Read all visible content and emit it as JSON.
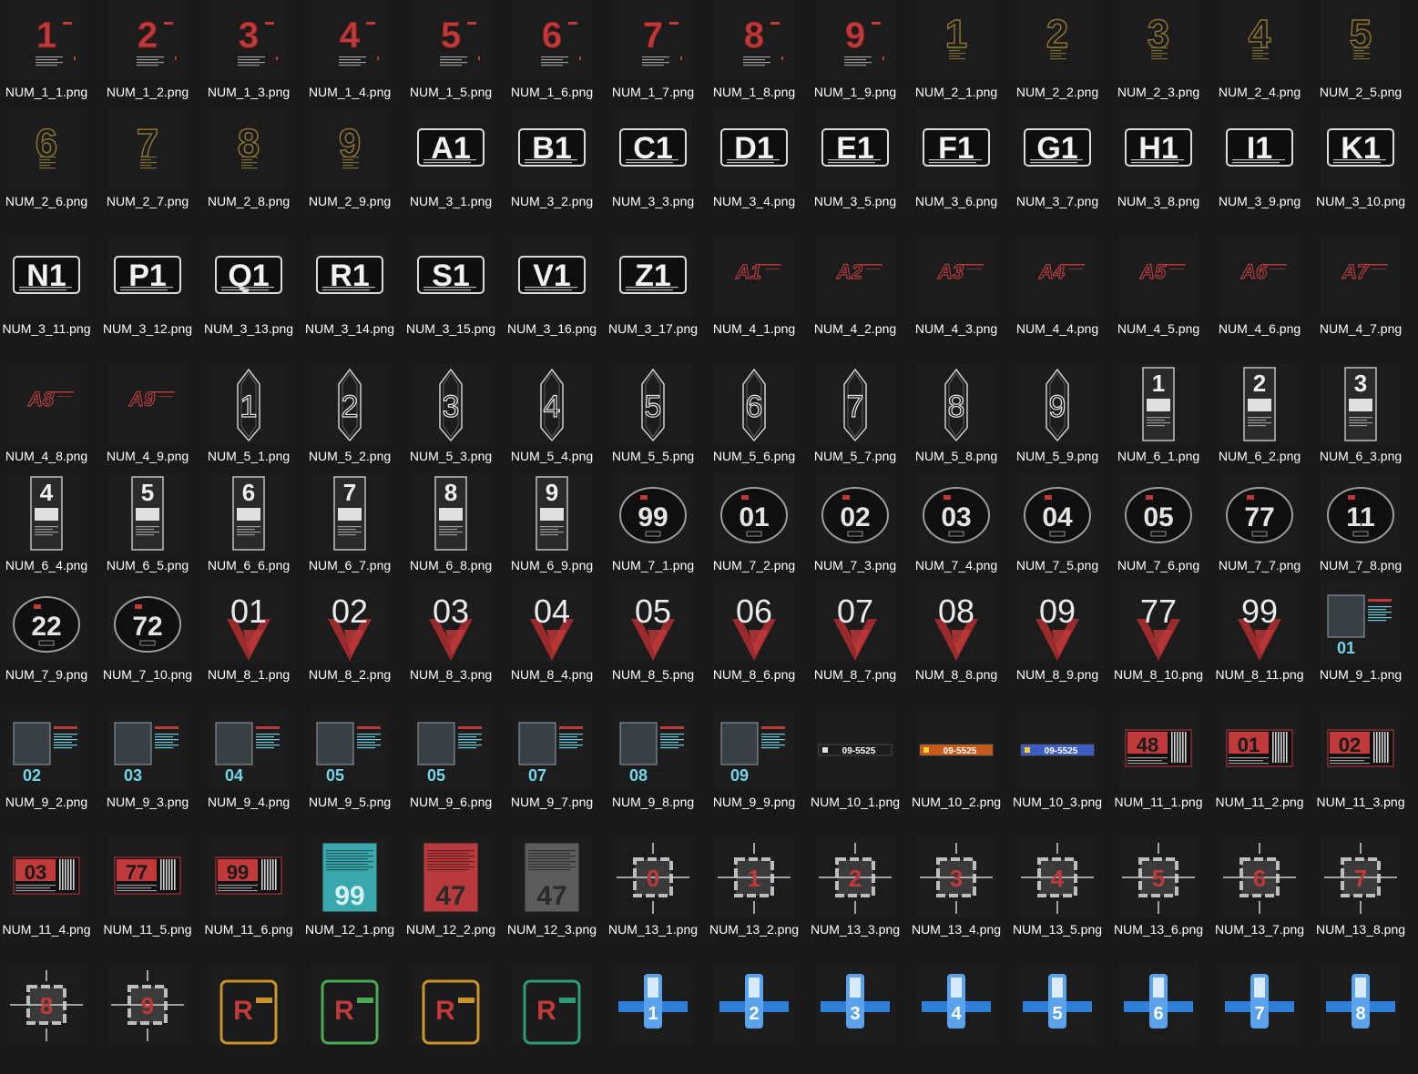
{
  "view": {
    "background": "#191919",
    "label_color": "#ffffff"
  },
  "files": [
    {
      "name": "NUM_1_1.png",
      "glyph": "1",
      "style": "red-block"
    },
    {
      "name": "NUM_1_2.png",
      "glyph": "2",
      "style": "red-block"
    },
    {
      "name": "NUM_1_3.png",
      "glyph": "3",
      "style": "red-block"
    },
    {
      "name": "NUM_1_4.png",
      "glyph": "4",
      "style": "red-block"
    },
    {
      "name": "NUM_1_5.png",
      "glyph": "5",
      "style": "red-block"
    },
    {
      "name": "NUM_1_6.png",
      "glyph": "6",
      "style": "red-block"
    },
    {
      "name": "NUM_1_7.png",
      "glyph": "7",
      "style": "red-block"
    },
    {
      "name": "NUM_1_8.png",
      "glyph": "8",
      "style": "red-block"
    },
    {
      "name": "NUM_1_9.png",
      "glyph": "9",
      "style": "red-block"
    },
    {
      "name": "NUM_2_1.png",
      "glyph": "1",
      "style": "gold-outline"
    },
    {
      "name": "NUM_2_2.png",
      "glyph": "2",
      "style": "gold-outline"
    },
    {
      "name": "NUM_2_3.png",
      "glyph": "3",
      "style": "gold-outline"
    },
    {
      "name": "NUM_2_4.png",
      "glyph": "4",
      "style": "gold-outline"
    },
    {
      "name": "NUM_2_5.png",
      "glyph": "5",
      "style": "gold-outline"
    },
    {
      "name": "NUM_2_6.png",
      "glyph": "6",
      "style": "gold-outline"
    },
    {
      "name": "NUM_2_7.png",
      "glyph": "7",
      "style": "gold-outline"
    },
    {
      "name": "NUM_2_8.png",
      "glyph": "8",
      "style": "gold-outline"
    },
    {
      "name": "NUM_2_9.png",
      "glyph": "9",
      "style": "gold-outline"
    },
    {
      "name": "NUM_3_1.png",
      "glyph": "A1",
      "style": "white-plate"
    },
    {
      "name": "NUM_3_2.png",
      "glyph": "B1",
      "style": "white-plate"
    },
    {
      "name": "NUM_3_3.png",
      "glyph": "C1",
      "style": "white-plate"
    },
    {
      "name": "NUM_3_4.png",
      "glyph": "D1",
      "style": "white-plate"
    },
    {
      "name": "NUM_3_5.png",
      "glyph": "E1",
      "style": "white-plate"
    },
    {
      "name": "NUM_3_6.png",
      "glyph": "F1",
      "style": "white-plate"
    },
    {
      "name": "NUM_3_7.png",
      "glyph": "G1",
      "style": "white-plate"
    },
    {
      "name": "NUM_3_8.png",
      "glyph": "H1",
      "style": "white-plate"
    },
    {
      "name": "NUM_3_9.png",
      "glyph": "I1",
      "style": "white-plate"
    },
    {
      "name": "NUM_3_10.png",
      "glyph": "K1",
      "style": "white-plate"
    },
    {
      "name": "NUM_3_11.png",
      "glyph": "N1",
      "style": "white-plate"
    },
    {
      "name": "NUM_3_12.png",
      "glyph": "P1",
      "style": "white-plate"
    },
    {
      "name": "NUM_3_13.png",
      "glyph": "Q1",
      "style": "white-plate"
    },
    {
      "name": "NUM_3_14.png",
      "glyph": "R1",
      "style": "white-plate"
    },
    {
      "name": "NUM_3_15.png",
      "glyph": "S1",
      "style": "white-plate"
    },
    {
      "name": "NUM_3_16.png",
      "glyph": "V1",
      "style": "white-plate"
    },
    {
      "name": "NUM_3_17.png",
      "glyph": "Z1",
      "style": "white-plate"
    },
    {
      "name": "NUM_4_1.png",
      "glyph": "A1",
      "style": "red-outline"
    },
    {
      "name": "NUM_4_2.png",
      "glyph": "A2",
      "style": "red-outline"
    },
    {
      "name": "NUM_4_3.png",
      "glyph": "A3",
      "style": "red-outline"
    },
    {
      "name": "NUM_4_4.png",
      "glyph": "A4",
      "style": "red-outline"
    },
    {
      "name": "NUM_4_5.png",
      "glyph": "A5",
      "style": "red-outline"
    },
    {
      "name": "NUM_4_6.png",
      "glyph": "A6",
      "style": "red-outline"
    },
    {
      "name": "NUM_4_7.png",
      "glyph": "A7",
      "style": "red-outline"
    },
    {
      "name": "NUM_4_8.png",
      "glyph": "A8",
      "style": "red-outline"
    },
    {
      "name": "NUM_4_9.png",
      "glyph": "A9",
      "style": "red-outline"
    },
    {
      "name": "NUM_5_1.png",
      "glyph": "1",
      "style": "floor-hex"
    },
    {
      "name": "NUM_5_2.png",
      "glyph": "2",
      "style": "floor-hex"
    },
    {
      "name": "NUM_5_3.png",
      "glyph": "3",
      "style": "floor-hex"
    },
    {
      "name": "NUM_5_4.png",
      "glyph": "4",
      "style": "floor-hex"
    },
    {
      "name": "NUM_5_5.png",
      "glyph": "5",
      "style": "floor-hex"
    },
    {
      "name": "NUM_5_6.png",
      "glyph": "6",
      "style": "floor-hex"
    },
    {
      "name": "NUM_5_7.png",
      "glyph": "7",
      "style": "floor-hex"
    },
    {
      "name": "NUM_5_8.png",
      "glyph": "8",
      "style": "floor-hex"
    },
    {
      "name": "NUM_5_9.png",
      "glyph": "9",
      "style": "floor-hex"
    },
    {
      "name": "NUM_6_1.png",
      "glyph": "1",
      "style": "tall-panel"
    },
    {
      "name": "NUM_6_2.png",
      "glyph": "2",
      "style": "tall-panel"
    },
    {
      "name": "NUM_6_3.png",
      "glyph": "3",
      "style": "tall-panel"
    },
    {
      "name": "NUM_6_4.png",
      "glyph": "4",
      "style": "tall-panel"
    },
    {
      "name": "NUM_6_5.png",
      "glyph": "5",
      "style": "tall-panel"
    },
    {
      "name": "NUM_6_6.png",
      "glyph": "6",
      "style": "tall-panel"
    },
    {
      "name": "NUM_6_7.png",
      "glyph": "7",
      "style": "tall-panel"
    },
    {
      "name": "NUM_6_8.png",
      "glyph": "8",
      "style": "tall-panel"
    },
    {
      "name": "NUM_6_9.png",
      "glyph": "9",
      "style": "tall-panel"
    },
    {
      "name": "NUM_7_1.png",
      "glyph": "99",
      "style": "round-badge"
    },
    {
      "name": "NUM_7_2.png",
      "glyph": "01",
      "style": "round-badge"
    },
    {
      "name": "NUM_7_3.png",
      "glyph": "02",
      "style": "round-badge"
    },
    {
      "name": "NUM_7_4.png",
      "glyph": "03",
      "style": "round-badge"
    },
    {
      "name": "NUM_7_5.png",
      "glyph": "04",
      "style": "round-badge"
    },
    {
      "name": "NUM_7_6.png",
      "glyph": "05",
      "style": "round-badge"
    },
    {
      "name": "NUM_7_7.png",
      "glyph": "77",
      "style": "round-badge"
    },
    {
      "name": "NUM_7_8.png",
      "glyph": "11",
      "style": "round-badge"
    },
    {
      "name": "NUM_7_9.png",
      "glyph": "22",
      "style": "round-badge"
    },
    {
      "name": "NUM_7_10.png",
      "glyph": "72",
      "style": "round-badge"
    },
    {
      "name": "NUM_8_1.png",
      "glyph": "01",
      "style": "red-chevron"
    },
    {
      "name": "NUM_8_2.png",
      "glyph": "02",
      "style": "red-chevron"
    },
    {
      "name": "NUM_8_3.png",
      "glyph": "03",
      "style": "red-chevron"
    },
    {
      "name": "NUM_8_4.png",
      "glyph": "04",
      "style": "red-chevron"
    },
    {
      "name": "NUM_8_5.png",
      "glyph": "05",
      "style": "red-chevron"
    },
    {
      "name": "NUM_8_6.png",
      "glyph": "06",
      "style": "red-chevron"
    },
    {
      "name": "NUM_8_7.png",
      "glyph": "07",
      "style": "red-chevron"
    },
    {
      "name": "NUM_8_8.png",
      "glyph": "08",
      "style": "red-chevron"
    },
    {
      "name": "NUM_8_9.png",
      "glyph": "09",
      "style": "red-chevron"
    },
    {
      "name": "NUM_8_10.png",
      "glyph": "77",
      "style": "red-chevron"
    },
    {
      "name": "NUM_8_11.png",
      "glyph": "99",
      "style": "red-chevron"
    },
    {
      "name": "NUM_9_1.png",
      "glyph": "01",
      "style": "cyan-tech"
    },
    {
      "name": "NUM_9_2.png",
      "glyph": "02",
      "style": "cyan-tech"
    },
    {
      "name": "NUM_9_3.png",
      "glyph": "03",
      "style": "cyan-tech"
    },
    {
      "name": "NUM_9_4.png",
      "glyph": "04",
      "style": "cyan-tech"
    },
    {
      "name": "NUM_9_5.png",
      "glyph": "05",
      "style": "cyan-tech"
    },
    {
      "name": "NUM_9_6.png",
      "glyph": "05",
      "style": "cyan-tech"
    },
    {
      "name": "NUM_9_7.png",
      "glyph": "07",
      "style": "cyan-tech"
    },
    {
      "name": "NUM_9_8.png",
      "glyph": "08",
      "style": "cyan-tech"
    },
    {
      "name": "NUM_9_9.png",
      "glyph": "09",
      "style": "cyan-tech"
    },
    {
      "name": "NUM_10_1.png",
      "glyph": "09-5525",
      "style": "strip-dark"
    },
    {
      "name": "NUM_10_2.png",
      "glyph": "09-5525",
      "style": "strip-orange"
    },
    {
      "name": "NUM_10_3.png",
      "glyph": "09-5525",
      "style": "strip-blue"
    },
    {
      "name": "NUM_11_1.png",
      "glyph": "48",
      "style": "red-barcode"
    },
    {
      "name": "NUM_11_2.png",
      "glyph": "01",
      "style": "red-barcode"
    },
    {
      "name": "NUM_11_3.png",
      "glyph": "02",
      "style": "red-barcode"
    },
    {
      "name": "NUM_11_4.png",
      "glyph": "03",
      "style": "red-barcode"
    },
    {
      "name": "NUM_11_5.png",
      "glyph": "77",
      "style": "red-barcode"
    },
    {
      "name": "NUM_11_6.png",
      "glyph": "99",
      "style": "red-barcode"
    },
    {
      "name": "NUM_12_1.png",
      "glyph": "99",
      "style": "card-teal"
    },
    {
      "name": "NUM_12_2.png",
      "glyph": "47",
      "style": "card-red"
    },
    {
      "name": "NUM_12_3.png",
      "glyph": "47",
      "style": "card-gray"
    },
    {
      "name": "NUM_13_1.png",
      "glyph": "0",
      "style": "gear-crosshair"
    },
    {
      "name": "NUM_13_2.png",
      "glyph": "1",
      "style": "gear-crosshair"
    },
    {
      "name": "NUM_13_3.png",
      "glyph": "2",
      "style": "gear-crosshair"
    },
    {
      "name": "NUM_13_4.png",
      "glyph": "3",
      "style": "gear-crosshair"
    },
    {
      "name": "NUM_13_5.png",
      "glyph": "4",
      "style": "gear-crosshair"
    },
    {
      "name": "NUM_13_6.png",
      "glyph": "5",
      "style": "gear-crosshair"
    },
    {
      "name": "NUM_13_7.png",
      "glyph": "6",
      "style": "gear-crosshair"
    },
    {
      "name": "NUM_13_8.png",
      "glyph": "7",
      "style": "gear-crosshair"
    },
    {
      "name": "",
      "glyph": "8",
      "style": "gear-crosshair"
    },
    {
      "name": "",
      "glyph": "9",
      "style": "gear-crosshair"
    },
    {
      "name": "",
      "glyph": "R",
      "style": "frame-gold"
    },
    {
      "name": "",
      "glyph": "R",
      "style": "frame-green"
    },
    {
      "name": "",
      "glyph": "R",
      "style": "frame-gold"
    },
    {
      "name": "",
      "glyph": "R",
      "style": "frame-teal"
    },
    {
      "name": "",
      "glyph": "1",
      "style": "blue-hub"
    },
    {
      "name": "",
      "glyph": "2",
      "style": "blue-hub"
    },
    {
      "name": "",
      "glyph": "3",
      "style": "blue-hub"
    },
    {
      "name": "",
      "glyph": "4",
      "style": "blue-hub"
    },
    {
      "name": "",
      "glyph": "5",
      "style": "blue-hub"
    },
    {
      "name": "",
      "glyph": "6",
      "style": "blue-hub"
    },
    {
      "name": "",
      "glyph": "7",
      "style": "blue-hub"
    },
    {
      "name": "",
      "glyph": "8",
      "style": "blue-hub"
    }
  ]
}
